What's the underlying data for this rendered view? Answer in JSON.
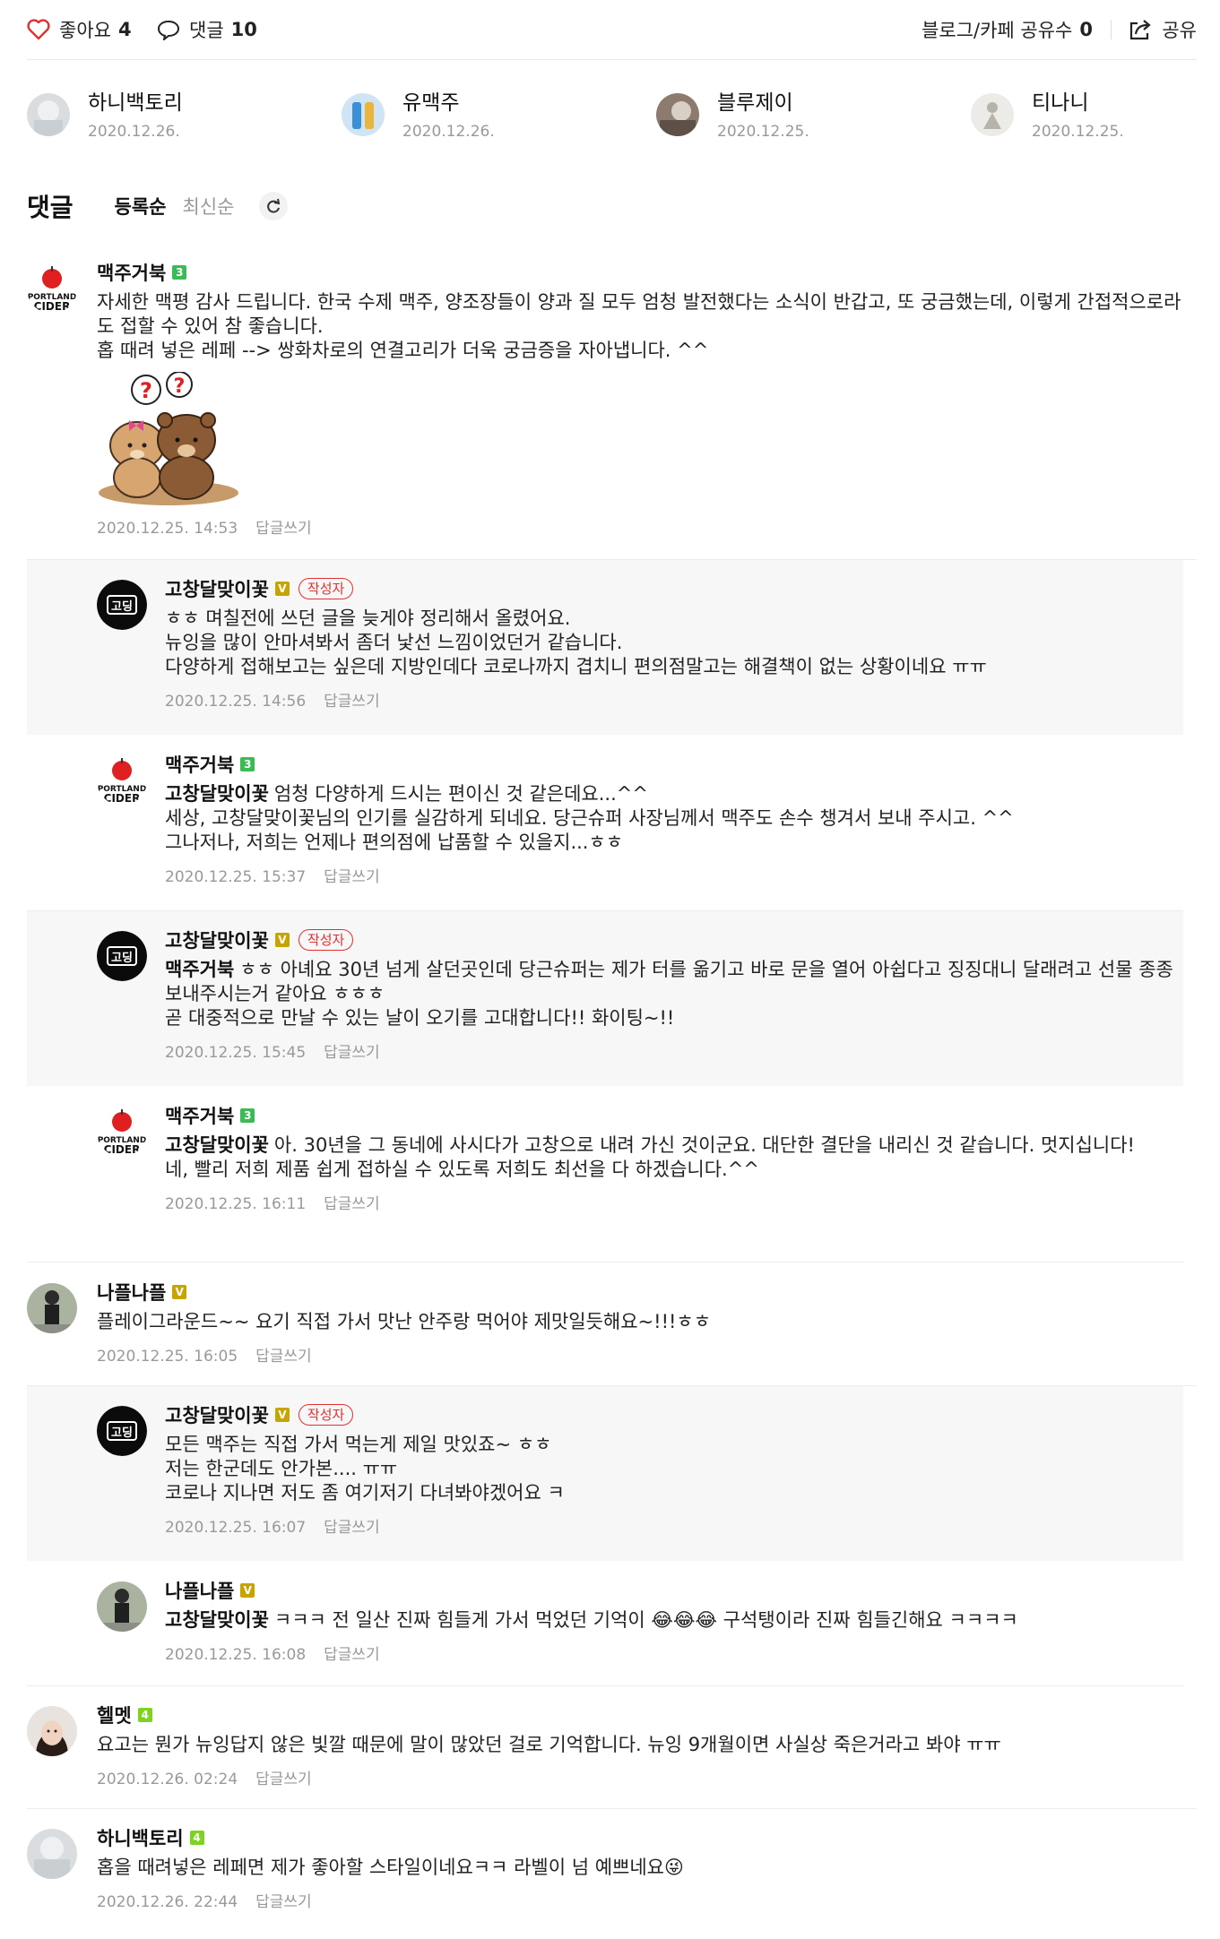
{
  "topbar": {
    "like_label": "좋아요",
    "like_count": "4",
    "comment_label": "댓글",
    "comment_count": "10",
    "share_count_label": "블로그/카페 공유수",
    "share_count": "0",
    "share_label": "공유"
  },
  "visitors": [
    {
      "name": "하니백토리",
      "date": "2020.12.26."
    },
    {
      "name": "유맥주",
      "date": "2020.12.26."
    },
    {
      "name": "블루제이",
      "date": "2020.12.25."
    },
    {
      "name": "티나니",
      "date": "2020.12.25."
    }
  ],
  "comments_header": {
    "title": "댓글",
    "sort_registered": "등록순",
    "sort_latest": "최신순"
  },
  "reply_label": "답글쓰기",
  "author_badge": "작성자",
  "comments": [
    {
      "name": "맥주거북",
      "badge": "3",
      "text": "자세한 맥평 감사 드립니다. 한국 수제 맥주, 양조장들이 양과 질 모두 엄청 발전했다는 소식이 반갑고, 또 궁금했는데, 이렇게 간접적으로라도 접할 수 있어 참 좋습니다.\n홉 때려 넣은 레페 --> 쌍화차로의 연결고리가 더욱 궁금증을 자아냅니다. ^^",
      "date": "2020.12.25. 14:53"
    },
    {
      "name": "고창달맞이꽃",
      "badge": "V",
      "text": "ㅎㅎ 며칠전에 쓰던 글을 늦게야 정리해서 올렸어요.\n뉴잉을 많이 안마셔봐서 좀더 낯선 느낌이었던거 같습니다.\n다양하게 접해보고는 싶은데 지방인데다 코로나까지 겹치니 편의점말고는 해결책이 없는 상황이네요 ㅠㅠ",
      "date": "2020.12.25. 14:56"
    },
    {
      "name": "맥주거북",
      "badge": "3",
      "mention": "고창달맞이꽃",
      "text": "엄청 다양하게 드시는 편이신 것 같은데요...^^\n세상, 고창달맞이꽃님의 인기를 실감하게 되네요. 당근슈퍼 사장님께서 맥주도 손수 챙겨서 보내 주시고. ^^\n그나저나, 저희는 언제나 편의점에 납품할 수 있을지...ㅎㅎ",
      "date": "2020.12.25. 15:37"
    },
    {
      "name": "고창달맞이꽃",
      "badge": "V",
      "mention": "맥주거북",
      "text": "ㅎㅎ 아녜요 30년 넘게 살던곳인데 당근슈퍼는 제가 터를 옮기고 바로 문을 열어 아쉽다고 징징대니 달래려고 선물 종종 보내주시는거 같아요 ㅎㅎㅎ\n곧 대중적으로 만날 수 있는 날이 오기를 고대합니다!! 화이팅~!!",
      "date": "2020.12.25. 15:45"
    },
    {
      "name": "맥주거북",
      "badge": "3",
      "mention": "고창달맞이꽃",
      "text": "아. 30년을 그 동네에 사시다가 고창으로 내려 가신 것이군요. 대단한 결단을 내리신 것 같습니다. 멋지십니다!\n네, 빨리 저희 제품 쉽게 접하실 수 있도록 저희도 최선을 다 하겠습니다.^^",
      "date": "2020.12.25. 16:11"
    },
    {
      "name": "나플나플",
      "badge": "V",
      "text": "플레이그라운드~~ 요기 직접 가서 맛난 안주랑 먹어야 제맛일듯해요~!!!ㅎㅎ",
      "date": "2020.12.25. 16:05"
    },
    {
      "name": "고창달맞이꽃",
      "badge": "V",
      "text": "모든 맥주는 직접 가서 먹는게 제일 맛있죠~ ㅎㅎ\n저는 한군데도 안가본.... ㅠㅠ\n코로나 지나면 저도 좀 여기저기 다녀봐야겠어요 ㅋ",
      "date": "2020.12.25. 16:07"
    },
    {
      "name": "나플나플",
      "badge": "V",
      "mention": "고창달맞이꽃",
      "text": "ㅋㅋㅋ 전 일산 진짜 힘들게 가서 먹었던 기억이 😂😂😂 구석탱이라 진짜 힘들긴해요 ㅋㅋㅋㅋ",
      "date": "2020.12.25. 16:08"
    },
    {
      "name": "헬멧",
      "badge": "4",
      "text": "요고는 뭔가 뉴잉답지 않은 빛깔 때문에 말이 많았던 걸로 기억합니다. 뉴잉 9개월이면 사실상 죽은거라고 봐야 ㅠㅠ",
      "date": "2020.12.26. 02:24"
    },
    {
      "name": "하니백토리",
      "badge": "4",
      "text": "홉을 때려넣은 레페면 제가 좋아할 스타일이네요ㅋㅋ 라벨이 넘 예쁘네요😜",
      "date": "2020.12.26. 22:44"
    }
  ]
}
